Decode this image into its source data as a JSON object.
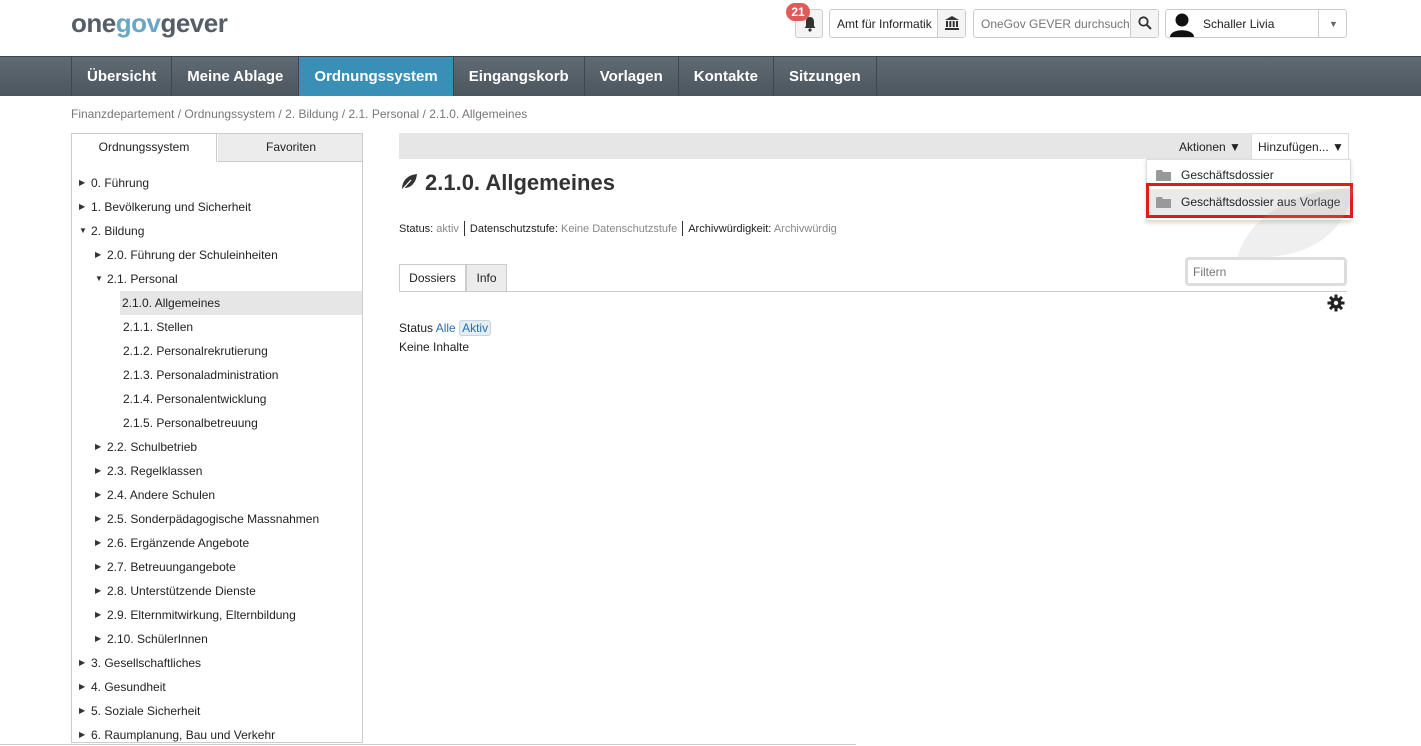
{
  "logo": {
    "part1": "one",
    "part2": "gov",
    "part3": "gever"
  },
  "header": {
    "notification_count": "21",
    "org_unit": "Amt für Informatik",
    "search_placeholder": "OneGov GEVER durchsuchen",
    "user_name": "Schaller Livia"
  },
  "nav": {
    "items": [
      {
        "label": "Übersicht"
      },
      {
        "label": "Meine Ablage"
      },
      {
        "label": "Ordnungssystem"
      },
      {
        "label": "Eingangskorb"
      },
      {
        "label": "Vorlagen"
      },
      {
        "label": "Kontakte"
      },
      {
        "label": "Sitzungen"
      }
    ],
    "active_index": 2
  },
  "breadcrumb": "Finanzdepartement / Ordnungssystem / 2. Bildung / 2.1. Personal / 2.1.0. Allgemeines",
  "tree": {
    "tabs": [
      "Ordnungssystem",
      "Favoriten"
    ],
    "items": [
      {
        "label": "0. Führung",
        "level": 0,
        "arrow": "right"
      },
      {
        "label": "1. Bevölkerung und Sicherheit",
        "level": 0,
        "arrow": "right"
      },
      {
        "label": "2. Bildung",
        "level": 0,
        "arrow": "down"
      },
      {
        "label": "2.0. Führung der Schuleinheiten",
        "level": 1,
        "arrow": "right"
      },
      {
        "label": "2.1. Personal",
        "level": 1,
        "arrow": "down"
      },
      {
        "label": "2.1.0. Allgemeines",
        "level": 2,
        "arrow": "",
        "selected": true
      },
      {
        "label": "2.1.1. Stellen",
        "level": 2,
        "arrow": ""
      },
      {
        "label": "2.1.2. Personalrekrutierung",
        "level": 2,
        "arrow": ""
      },
      {
        "label": "2.1.3. Personaladministration",
        "level": 2,
        "arrow": ""
      },
      {
        "label": "2.1.4. Personalentwicklung",
        "level": 2,
        "arrow": ""
      },
      {
        "label": "2.1.5. Personalbetreuung",
        "level": 2,
        "arrow": ""
      },
      {
        "label": "2.2. Schulbetrieb",
        "level": 1,
        "arrow": "right"
      },
      {
        "label": "2.3. Regelklassen",
        "level": 1,
        "arrow": "right"
      },
      {
        "label": "2.4. Andere Schulen",
        "level": 1,
        "arrow": "right"
      },
      {
        "label": "2.5. Sonderpädagogische Massnahmen",
        "level": 1,
        "arrow": "right"
      },
      {
        "label": "2.6. Ergänzende Angebote",
        "level": 1,
        "arrow": "right"
      },
      {
        "label": "2.7. Betreuungangebote",
        "level": 1,
        "arrow": "right"
      },
      {
        "label": "2.8. Unterstützende Dienste",
        "level": 1,
        "arrow": "right"
      },
      {
        "label": "2.9. Elternmitwirkung, Elternbildung",
        "level": 1,
        "arrow": "right"
      },
      {
        "label": "2.10. SchülerInnen",
        "level": 1,
        "arrow": "right"
      },
      {
        "label": "3. Gesellschaftliches",
        "level": 0,
        "arrow": "right"
      },
      {
        "label": "4. Gesundheit",
        "level": 0,
        "arrow": "right"
      },
      {
        "label": "5. Soziale Sicherheit",
        "level": 0,
        "arrow": "right"
      },
      {
        "label": "6. Raumplanung, Bau und Verkehr",
        "level": 0,
        "arrow": "right"
      }
    ]
  },
  "main": {
    "aktionen_label": "Aktionen ▼",
    "hinzufuegen_label": "Hinzufügen... ▼",
    "dropdown": [
      "Geschäftsdossier",
      "Geschäftsdossier aus Vorlage"
    ],
    "title": "2.1.0. Allgemeines",
    "status_label": "Status: ",
    "status_value": "aktiv",
    "privacy_label": "Datenschutzstufe: ",
    "privacy_value": "Keine Datenschutzstufe",
    "archive_label": "Archivwürdigkeit: ",
    "archive_value": "Archivwürdig",
    "tabs": [
      "Dossiers",
      "Info"
    ],
    "filter_placeholder": "Filtern",
    "status_filter_label": "Status ",
    "status_filter_all": "Alle",
    "status_filter_active": "Aktiv",
    "empty_text": "Keine Inhalte"
  },
  "colors": {
    "nav_bg": "#535d66",
    "nav_active": "#3a8fb7",
    "highlight": "#e31a1a",
    "badge": "#e05a5a"
  }
}
